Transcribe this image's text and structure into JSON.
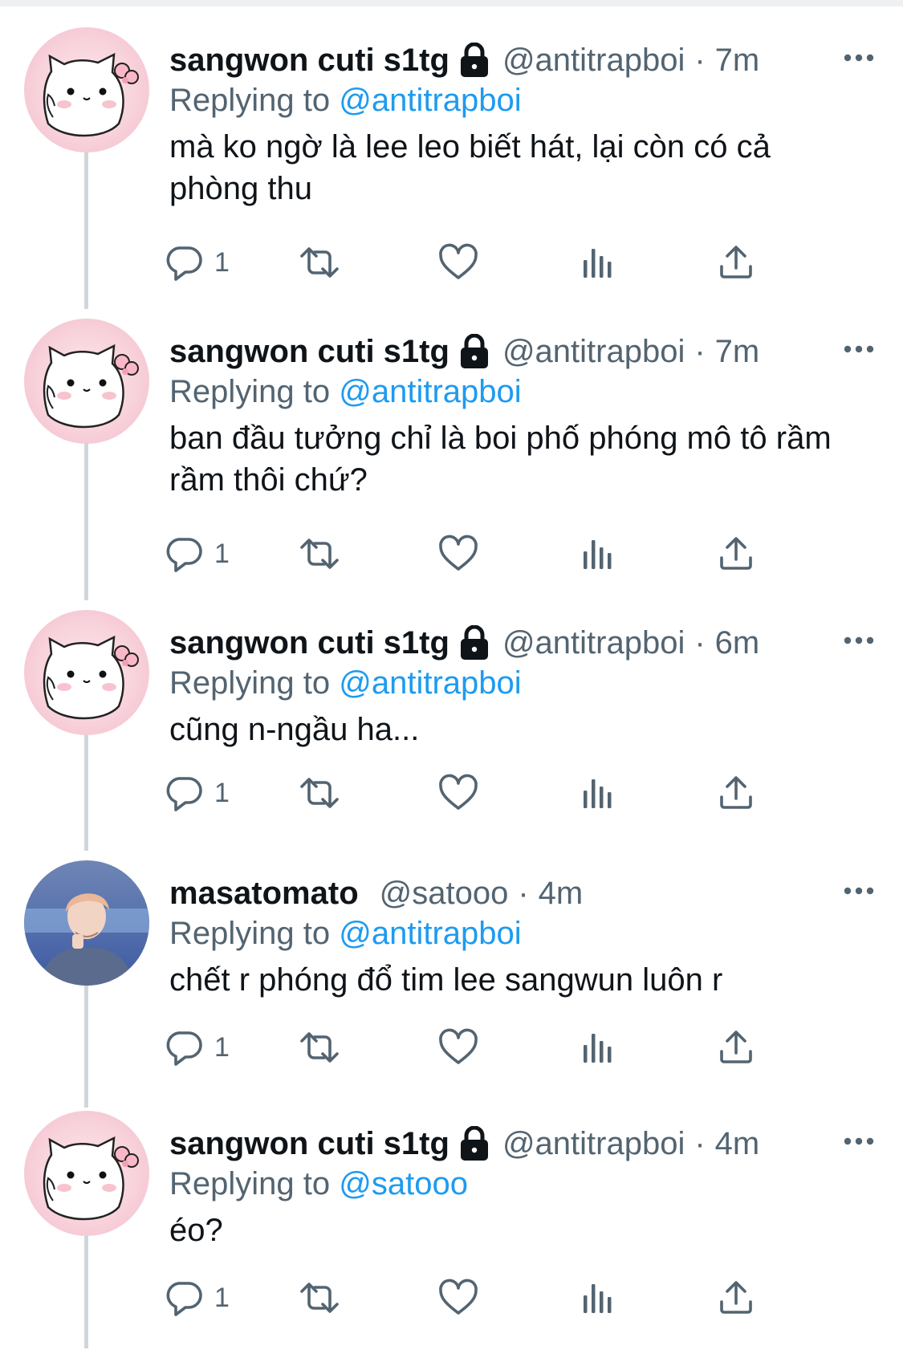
{
  "tweets": [
    {
      "display_name": "sangwon cuti s1tg",
      "protected": true,
      "handle": "@antitrapboi",
      "time": "7m",
      "replying_prefix": "Replying to",
      "replying_to": "@antitrapboi",
      "text": "mà ko ngờ là lee leo biết hát, lại còn có cả phòng thu",
      "reply_count": "1",
      "avatar": "pink-cat-avatar"
    },
    {
      "display_name": "sangwon cuti s1tg",
      "protected": true,
      "handle": "@antitrapboi",
      "time": "7m",
      "replying_prefix": "Replying to",
      "replying_to": "@antitrapboi",
      "text": "ban đầu tưởng chỉ là boi phố phóng mô tô rầm rầm thôi chứ?",
      "reply_count": "1",
      "avatar": "pink-cat-avatar"
    },
    {
      "display_name": "sangwon cuti s1tg",
      "protected": true,
      "handle": "@antitrapboi",
      "time": "6m",
      "replying_prefix": "Replying to",
      "replying_to": "@antitrapboi",
      "text": "cũng n-ngầu ha...",
      "reply_count": "1",
      "avatar": "pink-cat-avatar"
    },
    {
      "display_name": "masatomato",
      "protected": false,
      "handle": "@satooo",
      "time": "4m",
      "replying_prefix": "Replying to",
      "replying_to": "@antitrapboi",
      "text": "chết r phóng đổ tim lee sangwun luôn r",
      "reply_count": "1",
      "avatar": "person-photo-avatar"
    },
    {
      "display_name": "sangwon cuti s1tg",
      "protected": true,
      "handle": "@antitrapboi",
      "time": "4m",
      "replying_prefix": "Replying to",
      "replying_to": "@satooo",
      "text": "éo?",
      "reply_count": "1",
      "avatar": "pink-cat-avatar"
    }
  ],
  "separator": "·",
  "colors": {
    "text": "#0f1419",
    "muted": "#536471",
    "link": "#1d9bf0",
    "thread_line": "#cfd6dc"
  },
  "icons": [
    "reply-icon",
    "retweet-icon",
    "like-icon",
    "analytics-icon",
    "share-icon",
    "more-icon",
    "lock-icon"
  ]
}
